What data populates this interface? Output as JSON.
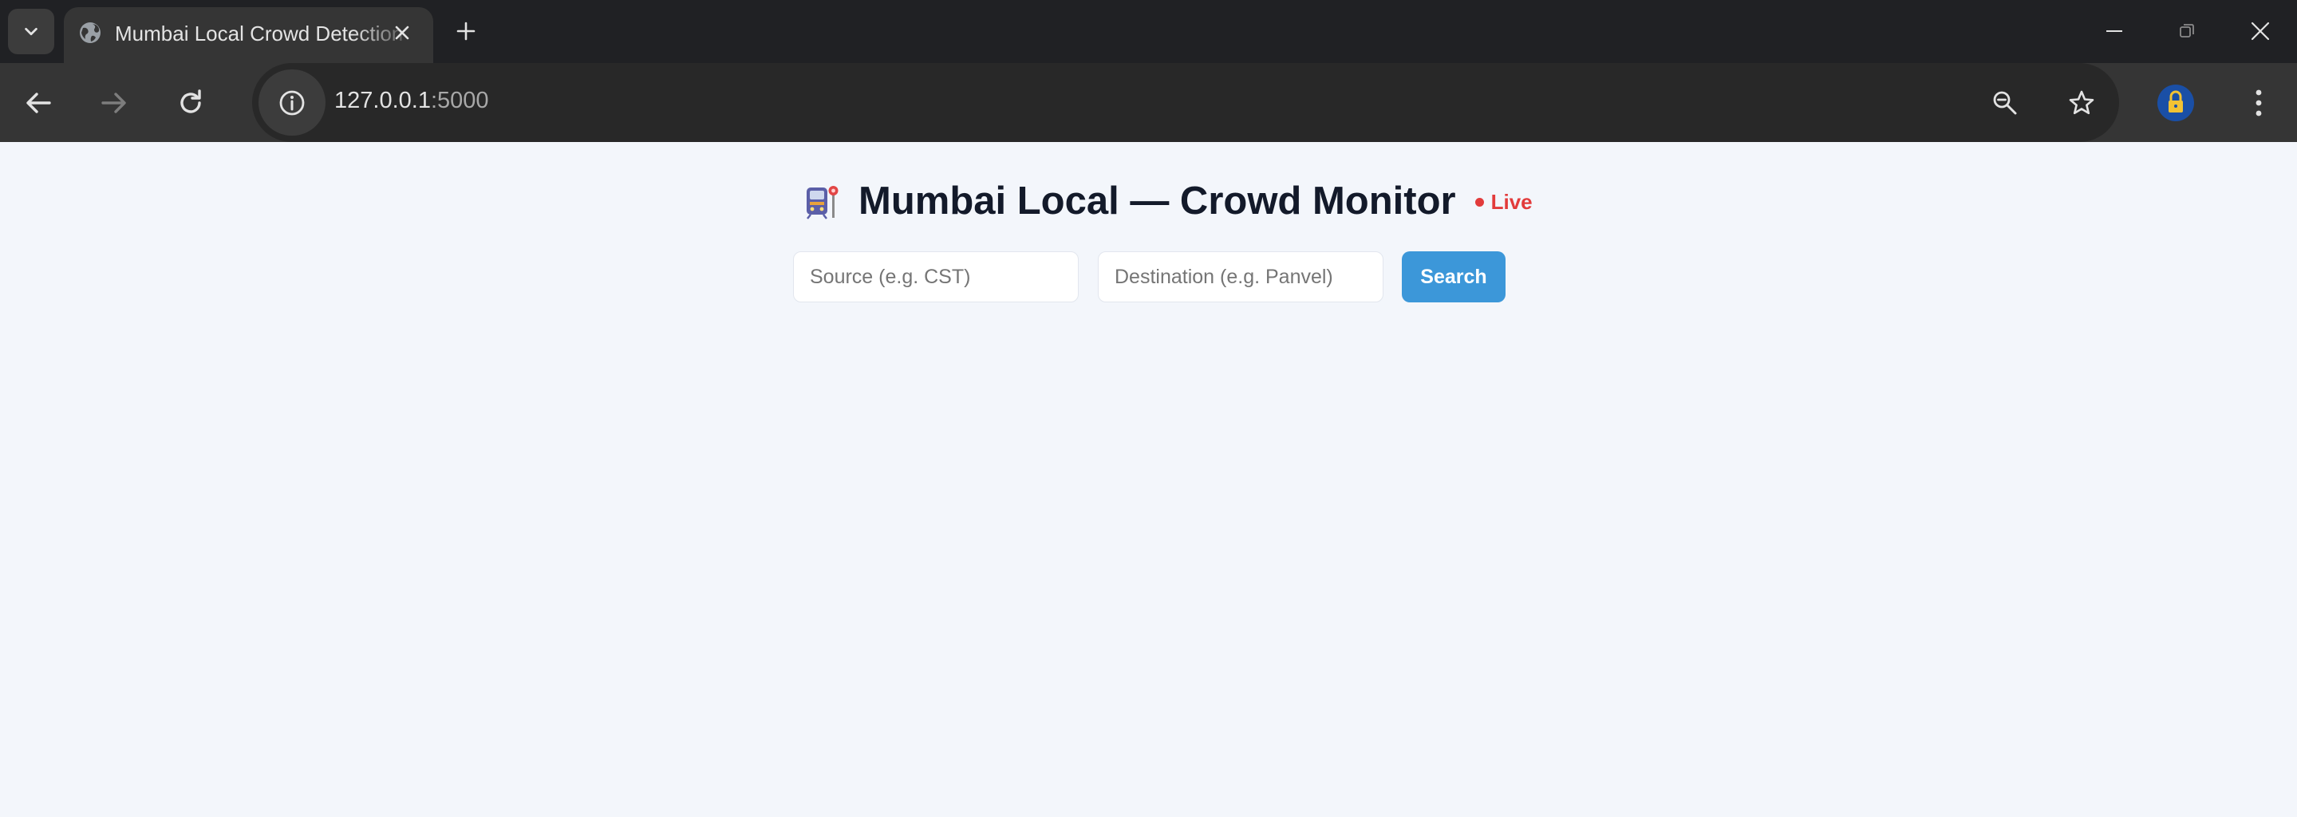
{
  "browser": {
    "tab": {
      "title": "Mumbai Local Crowd Detection"
    },
    "address": {
      "host": "127.0.0.1",
      "port": ":5000"
    }
  },
  "page": {
    "title": "Mumbai Local — Crowd Monitor",
    "live_label": "Live",
    "search": {
      "source_placeholder": "Source (e.g. CST)",
      "destination_placeholder": "Destination (e.g. Panvel)",
      "button_label": "Search"
    }
  },
  "colors": {
    "page_bg": "#f3f6fb",
    "title": "#131a2a",
    "live": "#e23b3b",
    "button": "#3c97d9"
  }
}
